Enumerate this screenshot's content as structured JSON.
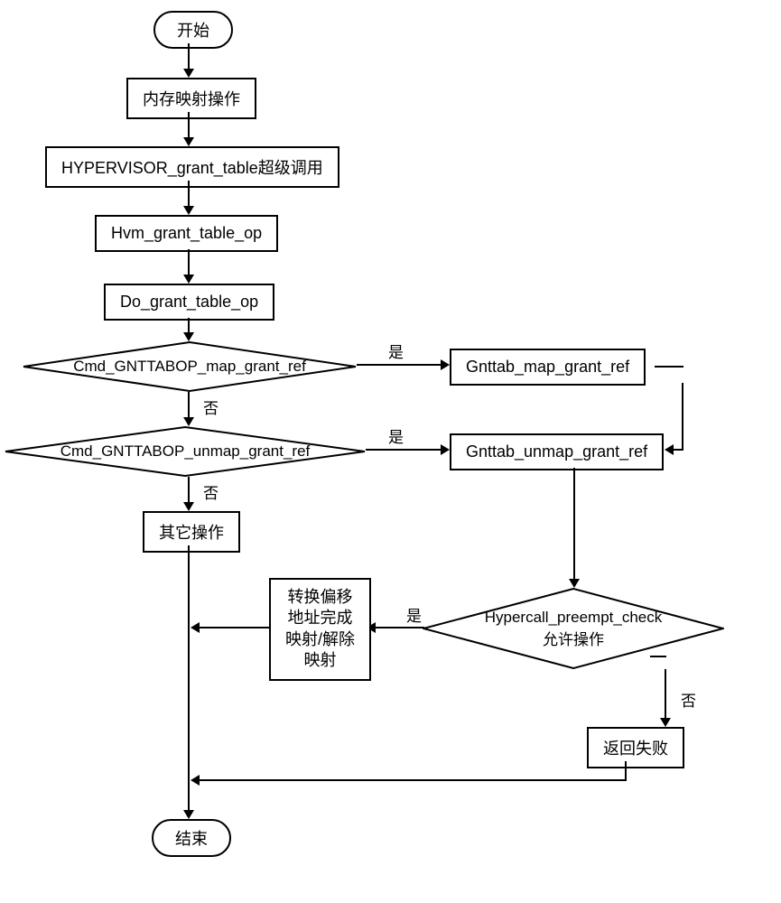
{
  "nodes": {
    "start": "开始",
    "memOp": "内存映射操作",
    "hypercall": "HYPERVISOR_grant_table超级调用",
    "hvmOp": "Hvm_grant_table_op",
    "doOp": "Do_grant_table_op",
    "mapDecision": "Cmd_GNTTABOP_map_grant_ref",
    "unmapDecision": "Cmd_GNTTABOP_unmap_grant_ref",
    "otherOp": "其它操作",
    "mapRef": "Gnttab_map_grant_ref",
    "unmapRef": "Gnttab_unmap_grant_ref",
    "preemptCheck": "Hypercall_preempt_check\n允许操作",
    "convertOffset": "转换偏移\n地址完成\n映射/解除\n映射",
    "returnFail": "返回失败",
    "end": "结束"
  },
  "labels": {
    "yes": "是",
    "no": "否"
  },
  "chart_data": {
    "type": "flowchart",
    "title": "Memory mapping flow",
    "nodes": [
      {
        "id": "start",
        "type": "terminator",
        "label": "开始"
      },
      {
        "id": "memOp",
        "type": "process",
        "label": "内存映射操作"
      },
      {
        "id": "hypercall",
        "type": "process",
        "label": "HYPERVISOR_grant_table超级调用"
      },
      {
        "id": "hvmOp",
        "type": "process",
        "label": "Hvm_grant_table_op"
      },
      {
        "id": "doOp",
        "type": "process",
        "label": "Do_grant_table_op"
      },
      {
        "id": "mapDecision",
        "type": "decision",
        "label": "Cmd_GNTTABOP_map_grant_ref"
      },
      {
        "id": "unmapDecision",
        "type": "decision",
        "label": "Cmd_GNTTABOP_unmap_grant_ref"
      },
      {
        "id": "otherOp",
        "type": "process",
        "label": "其它操作"
      },
      {
        "id": "mapRef",
        "type": "process",
        "label": "Gnttab_map_grant_ref"
      },
      {
        "id": "unmapRef",
        "type": "process",
        "label": "Gnttab_unmap_grant_ref"
      },
      {
        "id": "preemptCheck",
        "type": "decision",
        "label": "Hypercall_preempt_check 允许操作"
      },
      {
        "id": "convertOffset",
        "type": "process",
        "label": "转换偏移地址完成映射/解除映射"
      },
      {
        "id": "returnFail",
        "type": "process",
        "label": "返回失败"
      },
      {
        "id": "end",
        "type": "terminator",
        "label": "结束"
      }
    ],
    "edges": [
      {
        "from": "start",
        "to": "memOp"
      },
      {
        "from": "memOp",
        "to": "hypercall"
      },
      {
        "from": "hypercall",
        "to": "hvmOp"
      },
      {
        "from": "hvmOp",
        "to": "doOp"
      },
      {
        "from": "doOp",
        "to": "mapDecision"
      },
      {
        "from": "mapDecision",
        "to": "mapRef",
        "label": "是"
      },
      {
        "from": "mapDecision",
        "to": "unmapDecision",
        "label": "否"
      },
      {
        "from": "unmapDecision",
        "to": "unmapRef",
        "label": "是"
      },
      {
        "from": "unmapDecision",
        "to": "otherOp",
        "label": "否"
      },
      {
        "from": "mapRef",
        "to": "unmapRef"
      },
      {
        "from": "unmapRef",
        "to": "preemptCheck"
      },
      {
        "from": "preemptCheck",
        "to": "convertOffset",
        "label": "是"
      },
      {
        "from": "preemptCheck",
        "to": "returnFail",
        "label": "否"
      },
      {
        "from": "convertOffset",
        "to": "end"
      },
      {
        "from": "otherOp",
        "to": "end"
      },
      {
        "from": "returnFail",
        "to": "end"
      }
    ]
  }
}
